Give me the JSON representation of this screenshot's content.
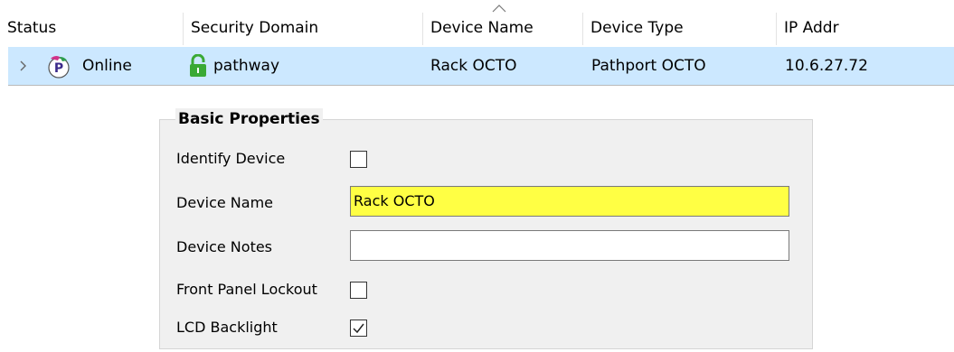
{
  "table": {
    "columns": [
      {
        "label": "Status"
      },
      {
        "label": "Security Domain"
      },
      {
        "label": "Device Name"
      },
      {
        "label": "Device Type"
      },
      {
        "label": "IP Addr"
      }
    ],
    "sorted_column": "Device Name",
    "rows": [
      {
        "status": "Online",
        "security_domain": "pathway",
        "device_name": "Rack OCTO",
        "device_type": "Pathport OCTO",
        "ip_addr": "10.6.27.72",
        "status_icon": "pathport-device-icon",
        "domain_icon": "unlocked-padlock-icon"
      }
    ]
  },
  "basic_properties": {
    "title": "Basic Properties",
    "identify_device": {
      "label": "Identify Device",
      "checked": false
    },
    "device_name": {
      "label": "Device Name",
      "value": "Rack OCTO"
    },
    "device_notes": {
      "label": "Device Notes",
      "value": ""
    },
    "front_panel_lockout": {
      "label": "Front Panel Lockout",
      "checked": false
    },
    "lcd_backlight": {
      "label": "LCD Backlight",
      "checked": true
    }
  },
  "colors": {
    "selected_row": "#cce8ff",
    "highlight_field": "#ffff44",
    "lock_green": "#3aa935"
  }
}
